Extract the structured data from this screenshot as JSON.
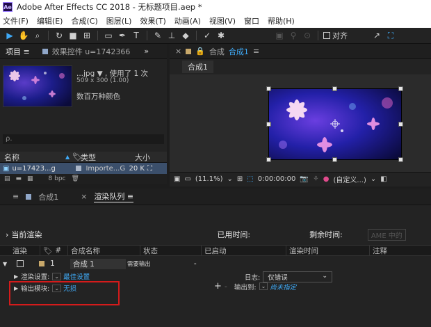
{
  "app": {
    "logo": "Ae",
    "title": "Adobe After Effects CC 2018 - 无标题项目.aep *"
  },
  "menu": [
    "文件(F)",
    "编辑(E)",
    "合成(C)",
    "图层(L)",
    "效果(T)",
    "动画(A)",
    "视图(V)",
    "窗口",
    "帮助(H)"
  ],
  "toolbar": {
    "snap_label": "对齐"
  },
  "project_panel": {
    "tab_label": "项目 ≡",
    "effects_tab": "效果控件 u=1742366",
    "more": "»",
    "item_name": "...jpg ▼ , 使用了 1 次",
    "item_dims": "509 x 300 (1.00)",
    "item_colors": "数百万种颜色",
    "search_icon": "ρ.",
    "col_name": "名称",
    "col_type": "类型",
    "col_size": "大小",
    "row_name": "u=17423...g",
    "row_type": "Importe...G",
    "row_size": "20 K",
    "footer_bpc": "8 bpc"
  },
  "viewer": {
    "tab_label": "合成",
    "tab_comp": "合成1",
    "breadcrumb": "合成1",
    "zoom": "(11.1%)",
    "timecode": "0:00:00:00",
    "view_mode": "(自定义...)"
  },
  "render_queue": {
    "tab_comp": "合成1",
    "tab_rq": "渲染队列 ≡",
    "current_render": "当前渲染",
    "elapsed_label": "已用时间:",
    "remaining_label": "剩余时间:",
    "ame_btn": "AME 中的",
    "columns": [
      "渲染",
      "#",
      "合成名称",
      "状态",
      "已启动",
      "渲染时间",
      "注释"
    ],
    "row": {
      "index": "1",
      "comp": "合成 1",
      "status": "需要输出",
      "started": "-"
    },
    "render_settings_label": "渲染设置:",
    "render_settings_value": "最佳设置",
    "log_label": "日志:",
    "log_value": "仅错误",
    "output_module_label": "输出模块:",
    "output_module_value": "无损",
    "output_to_label": "输出到:",
    "output_to_value": "尚未指定",
    "plus": "+",
    "minus": "-"
  }
}
